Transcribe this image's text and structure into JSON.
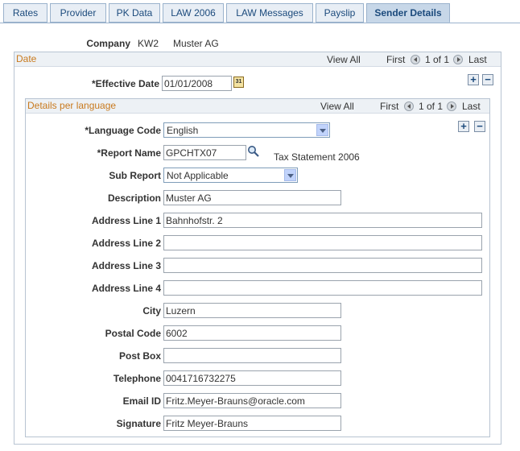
{
  "tabs": [
    {
      "label": "Rates"
    },
    {
      "label": "Provider"
    },
    {
      "label": "PK Data"
    },
    {
      "label": "LAW 2006"
    },
    {
      "label": "LAW Messages"
    },
    {
      "label": "Payslip"
    },
    {
      "label": "Sender Details"
    }
  ],
  "active_tab": "Sender Details",
  "company": {
    "label": "Company",
    "code": "KW2",
    "name": "Muster AG"
  },
  "date_section": {
    "title": "Date",
    "view_all": "View All",
    "first": "First",
    "range": "1 of 1",
    "last": "Last",
    "effective_date_label": "*Effective Date",
    "effective_date_value": "01/01/2008",
    "calendar_icon_text": "31"
  },
  "lang_section": {
    "title": "Details per language",
    "view_all": "View All",
    "first": "First",
    "range": "1 of 1",
    "last": "Last"
  },
  "fields": {
    "language_code": {
      "label": "*Language Code",
      "value": "English"
    },
    "report_name": {
      "label": "*Report Name",
      "value": "GPCHTX07",
      "description": "Tax Statement 2006"
    },
    "sub_report": {
      "label": "Sub Report",
      "value": "Not Applicable"
    },
    "description": {
      "label": "Description",
      "value": "Muster AG"
    },
    "address1": {
      "label": "Address Line 1",
      "value": "Bahnhofstr. 2"
    },
    "address2": {
      "label": "Address Line 2",
      "value": ""
    },
    "address3": {
      "label": "Address Line 3",
      "value": ""
    },
    "address4": {
      "label": "Address Line 4",
      "value": ""
    },
    "city": {
      "label": "City",
      "value": "Luzern"
    },
    "postal_code": {
      "label": "Postal Code",
      "value": "6002"
    },
    "post_box": {
      "label": "Post Box",
      "value": ""
    },
    "telephone": {
      "label": "Telephone",
      "value": "0041716732275"
    },
    "email": {
      "label": "Email ID",
      "value": "Fritz.Meyer-Brauns@oracle.com"
    },
    "signature": {
      "label": "Signature",
      "value": "Fritz Meyer-Brauns"
    }
  },
  "colors": {
    "tab_active": "#c7d7e8",
    "section_title": "#c97a1e",
    "link": "#1b4a7c"
  }
}
